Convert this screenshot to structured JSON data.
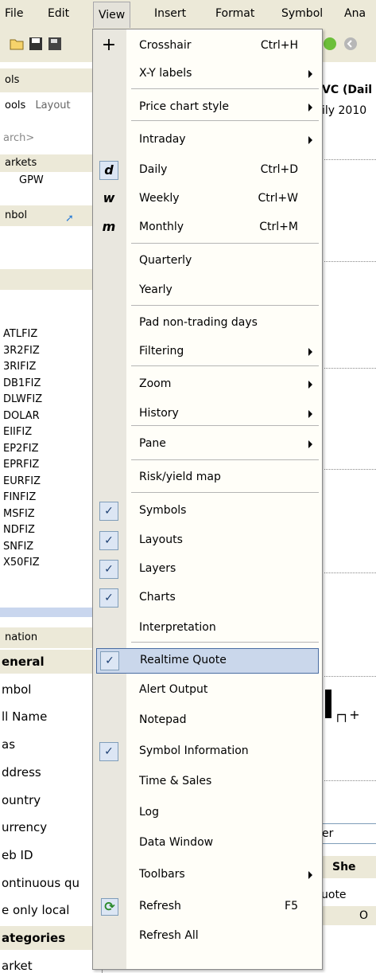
{
  "menubar": {
    "items": [
      {
        "label": "File",
        "id": "file"
      },
      {
        "label": "Edit",
        "id": "edit"
      },
      {
        "label": "View",
        "id": "view",
        "active": true
      },
      {
        "label": "Insert",
        "id": "insert"
      },
      {
        "label": "Format",
        "id": "format"
      },
      {
        "label": "Symbol",
        "id": "symbol"
      },
      {
        "label": "Ana",
        "id": "analysis"
      }
    ]
  },
  "left": {
    "tools_header": "ols",
    "tab_tools": "ools",
    "tab_layout": "Layout",
    "search_placeholder": "arch>",
    "markets_header": "arkets",
    "markets_item": "GPW",
    "symbol_header": "nbol",
    "symbols": [
      "ATLFIZ",
      "3R2FIZ",
      "3RIFIZ",
      "DB1FIZ",
      "DLWFIZ",
      "DOLAR",
      "EIIFIZ",
      "EP2FIZ",
      "EPRFIZ",
      "EURFIZ",
      "FINFIZ",
      "MSFIZ",
      "NDFIZ",
      "SNFIZ",
      "X50FIZ"
    ],
    "info_header": "nation",
    "info_rows": [
      {
        "label": "eneral",
        "bold": true
      },
      {
        "label": "mbol"
      },
      {
        "label": "ll Name"
      },
      {
        "label": "as"
      },
      {
        "label": "ddress"
      },
      {
        "label": "ountry"
      },
      {
        "label": "urrency"
      },
      {
        "label": "eb ID"
      },
      {
        "label": "ontinuous qu"
      },
      {
        "label": "e only local"
      },
      {
        "label": "ategories",
        "bold": true
      },
      {
        "label": "arket"
      }
    ]
  },
  "chart": {
    "title": "VC (Dail",
    "subtitle": "ily 2010",
    "panel_label": "er",
    "sheet_tab": "She",
    "quote_label": "uote",
    "col_label": "O"
  },
  "menu": {
    "items": [
      {
        "label": "Crosshair",
        "shortcut": "Ctrl+H",
        "icon": "crosshair-icon"
      },
      {
        "label": "X-Y labels",
        "submenu": true
      },
      {
        "label": "Price chart style",
        "submenu": true
      },
      {
        "label": "Intraday",
        "submenu": true
      },
      {
        "label": "Daily",
        "shortcut": "Ctrl+D",
        "icon": "daily-icon",
        "checked_box": true
      },
      {
        "label": "Weekly",
        "shortcut": "Ctrl+W",
        "icon": "weekly-icon"
      },
      {
        "label": "Monthly",
        "shortcut": "Ctrl+M",
        "icon": "monthly-icon"
      },
      {
        "label": "Quarterly"
      },
      {
        "label": "Yearly"
      },
      {
        "label": "Pad non-trading days"
      },
      {
        "label": "Filtering",
        "submenu": true
      },
      {
        "label": "Zoom",
        "submenu": true
      },
      {
        "label": "History",
        "submenu": true
      },
      {
        "label": "Pane",
        "submenu": true
      },
      {
        "label": "Risk/yield map"
      },
      {
        "label": "Symbols",
        "checked": true
      },
      {
        "label": "Layouts",
        "checked": true
      },
      {
        "label": "Layers",
        "checked": true
      },
      {
        "label": "Charts",
        "checked": true
      },
      {
        "label": "Interpretation"
      },
      {
        "label": "Realtime Quote",
        "checked": true,
        "highlighted": true
      },
      {
        "label": "Alert Output"
      },
      {
        "label": "Notepad"
      },
      {
        "label": "Symbol Information",
        "checked": true
      },
      {
        "label": "Time & Sales"
      },
      {
        "label": "Log"
      },
      {
        "label": "Data Window"
      },
      {
        "label": "Toolbars",
        "submenu": true
      },
      {
        "label": "Refresh",
        "shortcut": "F5",
        "icon": "refresh-icon"
      },
      {
        "label": "Refresh All"
      }
    ],
    "icon_glyphs": {
      "daily": "d",
      "weekly": "w",
      "monthly": "m",
      "crosshair": "+",
      "refresh": "⟳",
      "check": "✓"
    }
  },
  "colors": {
    "menu_bg": "#fffef8",
    "highlight": "#cad7eb",
    "highlight_border": "#4a6da3",
    "check_bg": "#dce6f4"
  }
}
